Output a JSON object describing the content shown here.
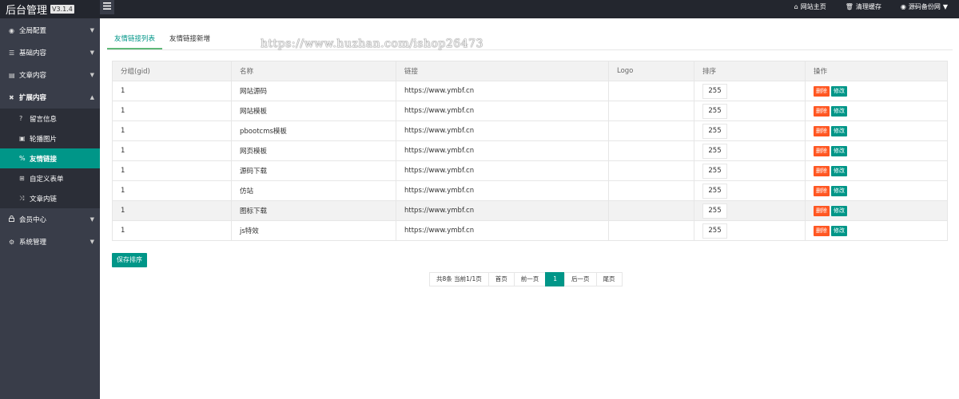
{
  "header": {
    "title": "后台管理",
    "version": "V3.1.4",
    "links": [
      {
        "icon": "home-icon",
        "glyph": "⌂",
        "label": "网站主页"
      },
      {
        "icon": "trash-icon",
        "glyph": "🗑",
        "label": "清理缓存"
      },
      {
        "icon": "user-icon",
        "glyph": "◉",
        "label": "源码备份网",
        "caret": "▼"
      }
    ]
  },
  "sidebar": {
    "items": [
      {
        "label": "全局配置",
        "icon": "globe-icon",
        "glyph": "◉",
        "caret": "▼"
      },
      {
        "label": "基础内容",
        "icon": "sliders-icon",
        "glyph": "☰",
        "caret": "▼"
      },
      {
        "label": "文章内容",
        "icon": "file-icon",
        "glyph": "▤",
        "caret": "▼"
      },
      {
        "label": "扩展内容",
        "icon": "expand-icon",
        "glyph": "✖",
        "caret": "▲"
      }
    ],
    "subitems": [
      {
        "label": "留言信息",
        "icon": "question-icon",
        "glyph": "?"
      },
      {
        "label": "轮播图片",
        "icon": "image-icon",
        "glyph": "▣"
      },
      {
        "label": "友情链接",
        "icon": "link-icon",
        "glyph": "%"
      },
      {
        "label": "自定义表单",
        "icon": "plus-square-icon",
        "glyph": "⊞"
      },
      {
        "label": "文章内链",
        "icon": "random-icon",
        "glyph": "⤨"
      }
    ],
    "bottom_items": [
      {
        "label": "会员中心",
        "icon": "lock-icon",
        "glyph": "▲",
        "caret": "▼"
      },
      {
        "label": "系统管理",
        "icon": "gear-icon",
        "glyph": "⚙",
        "caret": "▼"
      }
    ]
  },
  "tabs": [
    "友情链接列表",
    "友情链接新增"
  ],
  "watermark": "https://www.huzhan.com/ishop26473",
  "table": {
    "columns": [
      "分组(gid)",
      "名称",
      "链接",
      "Logo",
      "排序",
      "操作"
    ],
    "rows": [
      {
        "gid": "1",
        "name": "网站源码",
        "link": "https://www.ymbf.cn",
        "logo": "",
        "sort": "255"
      },
      {
        "gid": "1",
        "name": "网站模板",
        "link": "https://www.ymbf.cn",
        "logo": "",
        "sort": "255"
      },
      {
        "gid": "1",
        "name": "pbootcms模板",
        "link": "https://www.ymbf.cn",
        "logo": "",
        "sort": "255"
      },
      {
        "gid": "1",
        "name": "网页模板",
        "link": "https://www.ymbf.cn",
        "logo": "",
        "sort": "255"
      },
      {
        "gid": "1",
        "name": "源码下载",
        "link": "https://www.ymbf.cn",
        "logo": "",
        "sort": "255"
      },
      {
        "gid": "1",
        "name": "仿站",
        "link": "https://www.ymbf.cn",
        "logo": "",
        "sort": "255"
      },
      {
        "gid": "1",
        "name": "图标下载",
        "link": "https://www.ymbf.cn",
        "logo": "",
        "sort": "255",
        "highlight": true
      },
      {
        "gid": "1",
        "name": "js特效",
        "link": "https://www.ymbf.cn",
        "logo": "",
        "sort": "255"
      }
    ],
    "delete_label": "删除",
    "edit_label": "修改"
  },
  "save_label": "保存排序",
  "pagination": {
    "info": "共8条 当前1/1页",
    "first": "首页",
    "prev": "前一页",
    "current": "1",
    "next": "后一页",
    "last": "尾页"
  },
  "colors": {
    "accent": "#009688",
    "danger": "#ff5722",
    "sidebar_bg": "#393d49",
    "header_bg": "#23262e"
  }
}
